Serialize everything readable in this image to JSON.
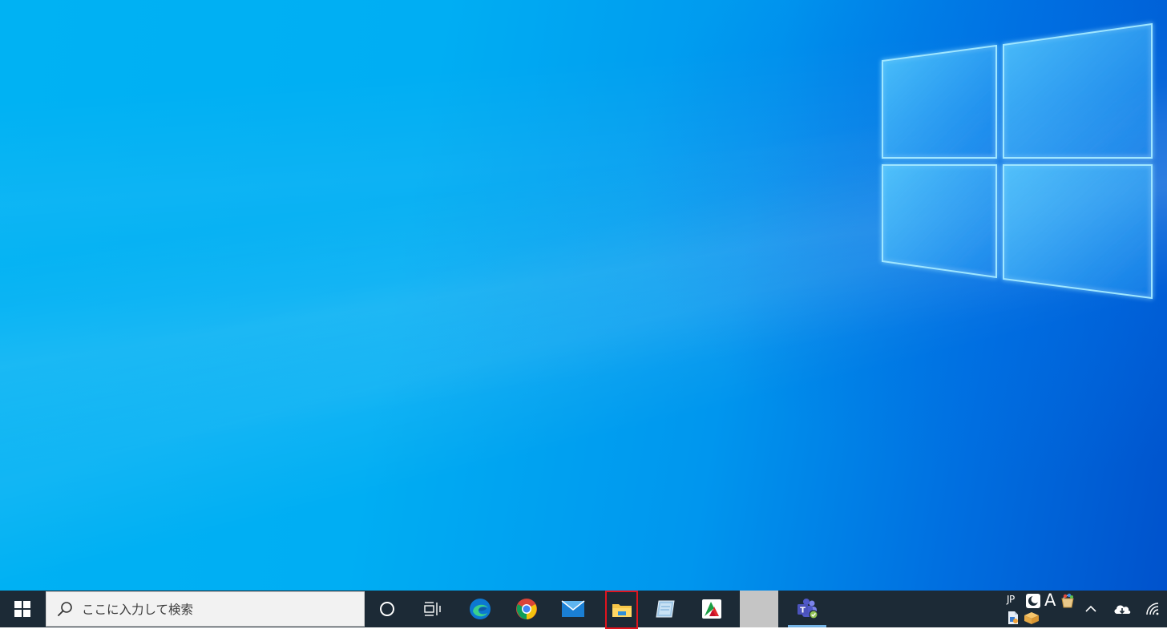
{
  "taskbar": {
    "search_placeholder": "ここに入力して検索",
    "ime_language": "JP",
    "ime_mode": "A",
    "highlight_color": "#e0141e"
  },
  "pinned_apps": [
    {
      "name": "Microsoft Edge",
      "icon": "edge-icon"
    },
    {
      "name": "Google Chrome",
      "icon": "chrome-icon"
    },
    {
      "name": "Mail",
      "icon": "mail-icon"
    },
    {
      "name": "File Explorer",
      "icon": "folder-icon",
      "highlighted": true
    },
    {
      "name": "Notebook app",
      "icon": "notebook-icon"
    },
    {
      "name": "PDF app",
      "icon": "pdf-icon"
    },
    {
      "name": "Blank app",
      "icon": "blank-icon"
    },
    {
      "name": "Microsoft Teams",
      "icon": "teams-icon",
      "active": true
    }
  ],
  "tray_icons": [
    "moon-icon",
    "paint-bucket-icon",
    "document-icon",
    "package-icon",
    "chevron-up-icon",
    "onedrive-icon",
    "wifi-icon"
  ]
}
